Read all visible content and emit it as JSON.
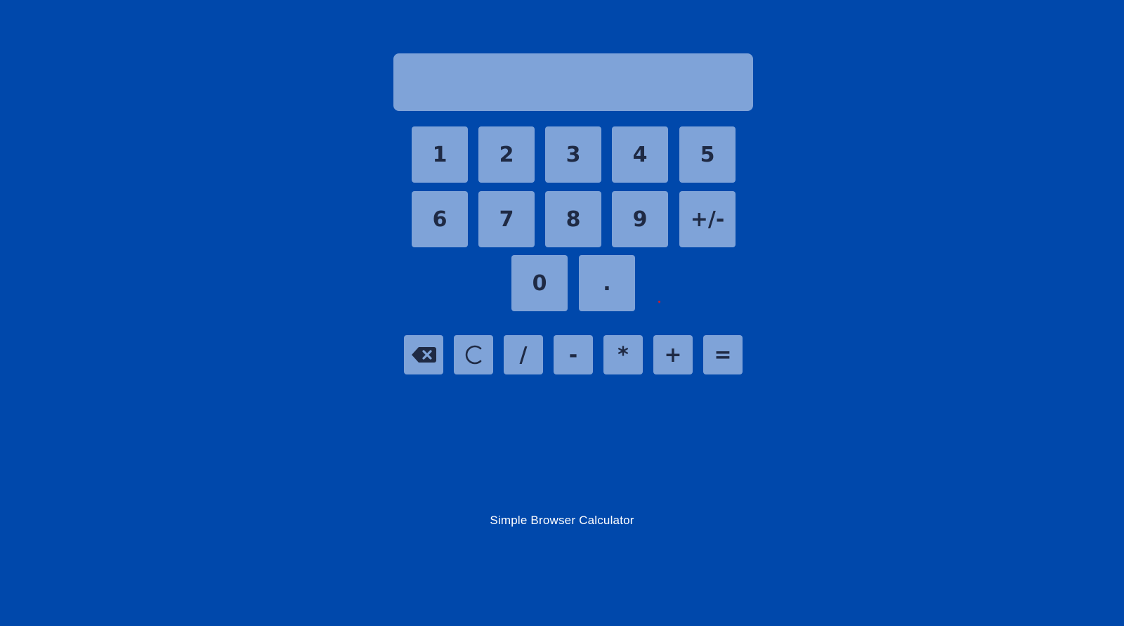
{
  "display": {
    "value": ""
  },
  "keypad": {
    "k1": "1",
    "k2": "2",
    "k3": "3",
    "k4": "4",
    "k5": "5",
    "k6": "6",
    "k7": "7",
    "k8": "8",
    "k9": "9",
    "sign": "+/-",
    "k0": "0",
    "decimal": "."
  },
  "operators": {
    "backspace_icon": "backspace-icon",
    "clear_icon": "clear-icon",
    "divide": "/",
    "subtract": "-",
    "multiply": "*",
    "add": "+",
    "equals": "="
  },
  "footer": {
    "text": "Simple Browser Calculator"
  },
  "colors": {
    "background": "#0048ab",
    "key": "#7fa3d8",
    "key_text": "#1f2a44",
    "marker": "#d11a2a"
  }
}
